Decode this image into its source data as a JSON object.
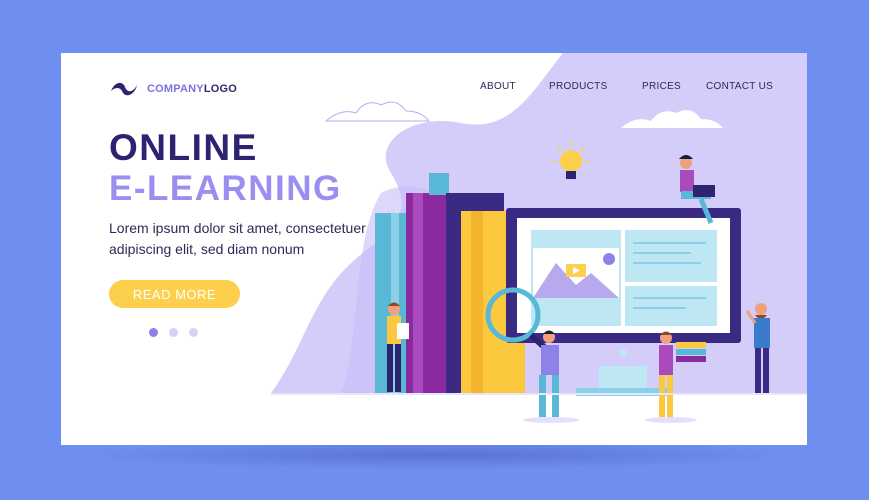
{
  "logo": {
    "part1": "COMPANY",
    "part2": "LOGO",
    "icon": "wave-logo-icon"
  },
  "nav": {
    "items": [
      "ABOUT",
      "PRODUCTS",
      "PRICES",
      "CONTACT US"
    ]
  },
  "hero": {
    "title_line1": "ONLINE",
    "title_line2": "E-LEARNING",
    "description": "Lorem ipsum dolor sit amet, consectetuer adipiscing elit, sed diam nonum",
    "cta_label": "READ MORE"
  },
  "carousel": {
    "count": 3,
    "active_index": 1
  },
  "colors": {
    "page_bg": "#6f8ff0",
    "blob": "#d4cdfa",
    "title_dark": "#2d2470",
    "title_light": "#9a8ff0",
    "cta": "#fcd04c"
  },
  "illustration": {
    "icons": [
      "lightbulb-icon",
      "magnifier-icon",
      "video-play-icon",
      "cloud-icon"
    ]
  }
}
